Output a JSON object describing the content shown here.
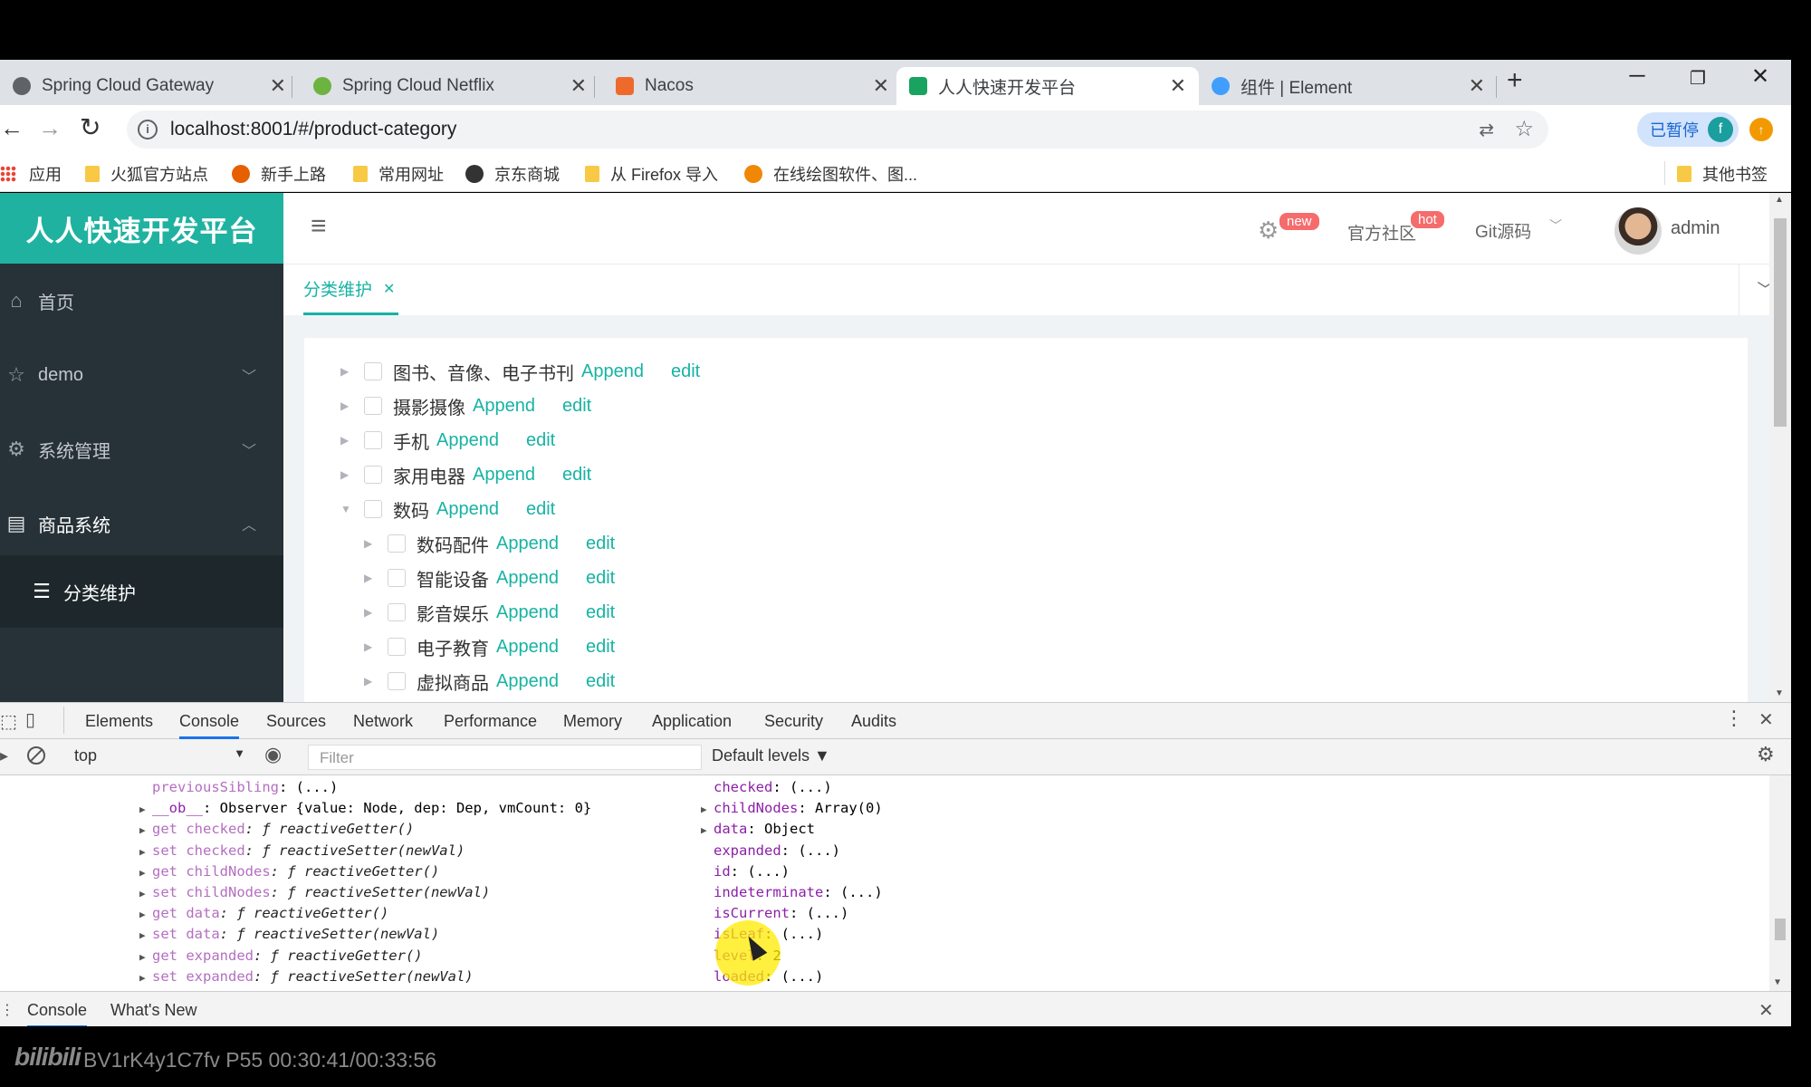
{
  "browser": {
    "tabs": [
      {
        "title": "Spring Cloud Gateway",
        "favicon_color": "#5f6368"
      },
      {
        "title": "Spring Cloud Netflix",
        "favicon_color": "#6db33f"
      },
      {
        "title": "Nacos",
        "favicon_color": "#ee6a2c"
      },
      {
        "title": "人人快速开发平台",
        "favicon_color": "#1aa260"
      },
      {
        "title": "组件 | Element",
        "favicon_color": "#409eff"
      }
    ],
    "new_tab": "+",
    "url": "localhost:8001/#/product-category",
    "profile_label": "已暂停",
    "profile_initial": "f"
  },
  "bookmarks": [
    {
      "label": "应用",
      "icon": "apps-grid-icon"
    },
    {
      "label": "火狐官方站点",
      "icon": "folder-icon"
    },
    {
      "label": "新手上路",
      "icon": "firefox-icon"
    },
    {
      "label": "常用网址",
      "icon": "folder-icon"
    },
    {
      "label": "京东商城",
      "icon": "globe-icon"
    },
    {
      "label": "从 Firefox 导入",
      "icon": "folder-icon"
    },
    {
      "label": "在线绘图软件、图...",
      "icon": "drawio-icon"
    },
    {
      "label": "其他书签",
      "icon": "folder-icon"
    }
  ],
  "app": {
    "brand": "人人快速开发平台",
    "menu": [
      {
        "label": "首页",
        "icon": "home-icon"
      },
      {
        "label": "demo",
        "icon": "star-icon"
      },
      {
        "label": "系统管理",
        "icon": "gear-icon"
      },
      {
        "label": "商品系统",
        "icon": "product-icon"
      }
    ],
    "submenu": [
      {
        "label": "分类维护",
        "icon": "list-icon"
      }
    ],
    "header": {
      "badge_new": "new",
      "community": "官方社区",
      "badge_hot": "hot",
      "git": "Git源码",
      "user": "admin"
    },
    "open_tab": "分类维护",
    "tree": [
      {
        "label": "图书、音像、电子书刊",
        "level": 1,
        "expanded": false
      },
      {
        "label": "摄影摄像",
        "level": 1,
        "expanded": false
      },
      {
        "label": "手机",
        "level": 1,
        "expanded": false
      },
      {
        "label": "家用电器",
        "level": 1,
        "expanded": false
      },
      {
        "label": "数码",
        "level": 1,
        "expanded": true
      },
      {
        "label": "数码配件",
        "level": 2,
        "expanded": false
      },
      {
        "label": "智能设备",
        "level": 2,
        "expanded": false
      },
      {
        "label": "影音娱乐",
        "level": 2,
        "expanded": false
      },
      {
        "label": "电子教育",
        "level": 2,
        "expanded": false
      },
      {
        "label": "虚拟商品",
        "level": 2,
        "expanded": false
      }
    ],
    "append_label": "Append",
    "edit_label": "edit",
    "accent": "#17b3a3"
  },
  "devtools": {
    "tabs": [
      "Elements",
      "Console",
      "Sources",
      "Network",
      "Performance",
      "Memory",
      "Application",
      "Security",
      "Audits"
    ],
    "active_tab": "Console",
    "context": "top",
    "filter_placeholder": "Filter",
    "levels": "Default levels ▼",
    "left_lines": [
      {
        "tri": "",
        "key": "previousSibling",
        "rest": ": (...)",
        "dim": true
      },
      {
        "tri": "▶",
        "key": "__ob__",
        "rest": ": Observer {value: Node, dep: Dep, vmCount: 0}",
        "dim": false
      },
      {
        "tri": "▶",
        "key": "get checked",
        "rest": ": ƒ reactiveGetter()",
        "dim": true
      },
      {
        "tri": "▶",
        "key": "set checked",
        "rest": ": ƒ reactiveSetter(newVal)",
        "dim": true
      },
      {
        "tri": "▶",
        "key": "get childNodes",
        "rest": ": ƒ reactiveGetter()",
        "dim": true
      },
      {
        "tri": "▶",
        "key": "set childNodes",
        "rest": ": ƒ reactiveSetter(newVal)",
        "dim": true
      },
      {
        "tri": "▶",
        "key": "get data",
        "rest": ": ƒ reactiveGetter()",
        "dim": true
      },
      {
        "tri": "▶",
        "key": "set data",
        "rest": ": ƒ reactiveSetter(newVal)",
        "dim": true
      },
      {
        "tri": "▶",
        "key": "get expanded",
        "rest": ": ƒ reactiveGetter()",
        "dim": true
      },
      {
        "tri": "▶",
        "key": "set expanded",
        "rest": ": ƒ reactiveSetter(newVal)",
        "dim": true
      }
    ],
    "right_lines": [
      {
        "tri": "",
        "key": "checked",
        "rest": ": (...)"
      },
      {
        "tri": "▶",
        "key": "childNodes",
        "rest": ": Array(0)"
      },
      {
        "tri": "▶",
        "key": "data",
        "rest": ": Object"
      },
      {
        "tri": "",
        "key": "expanded",
        "rest": ": (...)"
      },
      {
        "tri": "",
        "key": "id",
        "rest": ": (...)"
      },
      {
        "tri": "",
        "key": "indeterminate",
        "rest": ": (...)"
      },
      {
        "tri": "",
        "key": "isCurrent",
        "rest": ": (...)"
      },
      {
        "tri": "",
        "key": "isLeaf",
        "rest": ": (...)"
      },
      {
        "tri": "",
        "key": "level",
        "rest": ": 2"
      },
      {
        "tri": "",
        "key": "loaded",
        "rest": ": (...)"
      }
    ],
    "drawer_tabs": [
      "Console",
      "What's New"
    ]
  },
  "video": {
    "logo": "bilibili",
    "info": "BV1rK4y1C7fv P55 00:30:41/00:33:56"
  }
}
